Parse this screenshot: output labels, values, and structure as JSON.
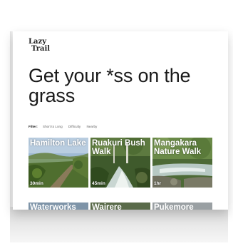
{
  "logo": {
    "line1": "Lazy",
    "line2": "Trail"
  },
  "headline": "Get your *ss on the grass",
  "filters": {
    "label": "Filter:",
    "options": [
      "Short to Long",
      "Difficulty",
      "Nearby"
    ]
  },
  "trails": [
    {
      "name": "Hamilton Lake",
      "duration": "30min"
    },
    {
      "name": "Ruakuri Bush Walk",
      "duration": "45min"
    },
    {
      "name": "Mangakara Nature Walk",
      "duration": "1hr"
    }
  ],
  "trails_row2": [
    {
      "name": "Waterworks"
    },
    {
      "name": "Wairere"
    },
    {
      "name": "Pukemore"
    }
  ],
  "colors": {
    "text": "#1a1a1a",
    "card_text": "#ffffff",
    "background": "#ffffff"
  }
}
